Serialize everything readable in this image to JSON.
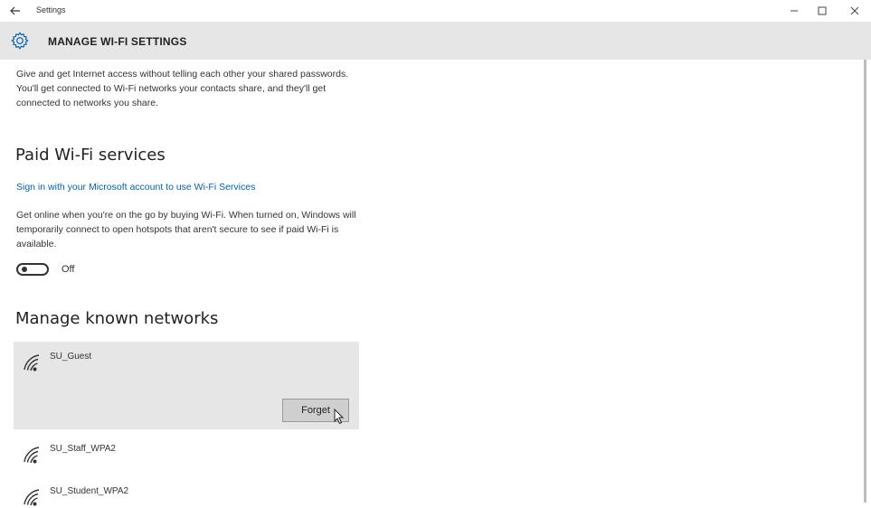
{
  "window": {
    "app_title": "Settings",
    "minimize_glyph": "–",
    "maximize_glyph": "☐",
    "close_glyph": "✕"
  },
  "header": {
    "title": "MANAGE WI-FI SETTINGS",
    "icon": "gear-icon"
  },
  "intro_text": "Give and get Internet access without telling each other your shared passwords. You'll get connected to Wi-Fi networks your contacts share, and they'll get connected to networks you share.",
  "paid_wifi": {
    "heading": "Paid Wi-Fi services",
    "sign_in_link": "Sign in with your Microsoft account to use Wi-Fi Services",
    "description": "Get online when you're on the go by buying Wi-Fi. When turned on, Windows will temporarily connect to open hotspots that aren't secure to see if paid Wi-Fi is available.",
    "toggle_state": "Off"
  },
  "known_networks": {
    "heading": "Manage known networks",
    "forget_label": "Forget",
    "networks": [
      {
        "name": "SU_Guest",
        "selected": true
      },
      {
        "name": "SU_Staff_WPA2",
        "selected": false
      },
      {
        "name": "SU_Student_WPA2",
        "selected": false
      }
    ]
  },
  "colors": {
    "header_bg": "#e6e6e6",
    "link": "#0063b1",
    "selected_row_bg": "#e6e6e6",
    "accent": "#0063b1"
  }
}
